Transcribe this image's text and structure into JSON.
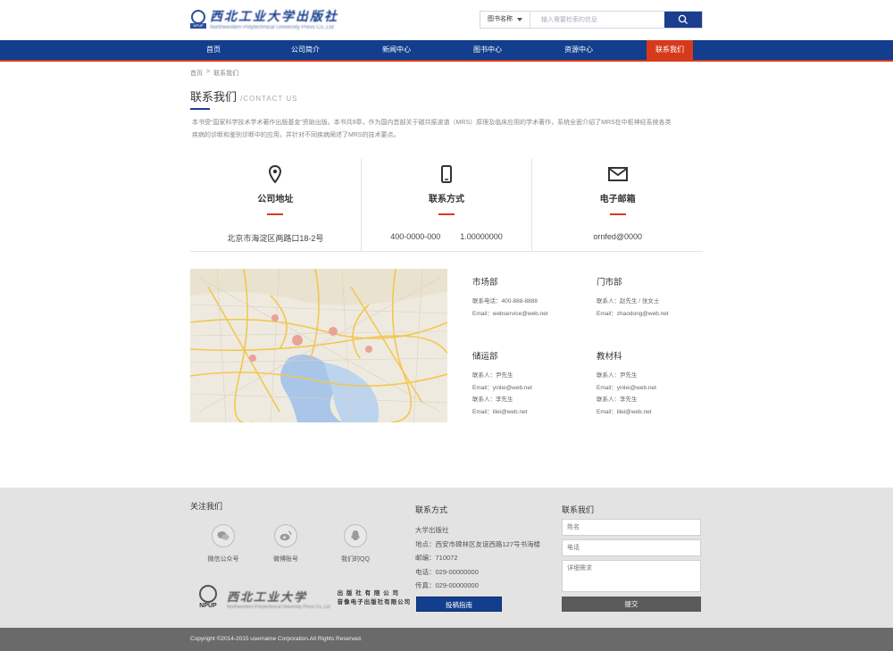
{
  "header": {
    "logo_cn": "西北工业大学出版社",
    "logo_en": "Northwestern Polytechnical University Press Co.,Ltd",
    "logo_mark_text": "NPUP",
    "search": {
      "category": "图书名称",
      "placeholder": "输入需要检索的信息"
    }
  },
  "nav": {
    "items": [
      {
        "label": "首页"
      },
      {
        "label": "公司简介"
      },
      {
        "label": "新闻中心"
      },
      {
        "label": "图书中心"
      },
      {
        "label": "资源中心"
      },
      {
        "label": "联系我们"
      }
    ]
  },
  "breadcrumb": {
    "home": "首页",
    "separator": ">",
    "current": "联系我们"
  },
  "page": {
    "title": "联系我们",
    "title_en": "/CONTACT US",
    "intro_line1": "本书受“国家科学技术学术著作出版基金”资助出版。本书共9章，作为国内首部关于磁共振波谱（MRS）原理及临床应用的学术著作，系统全面介绍了MRS在中枢神经系统各类",
    "intro_line2": "疾病的诊断和鉴别诊断中的应用，并针对不同疾病阐述了MRS的技术要点。"
  },
  "contact_cols": [
    {
      "title": "公司地址",
      "value": "北京市海淀区两路口18-2号"
    },
    {
      "title": "联系方式",
      "value1": "400-0000-000",
      "value2": "1.00000000"
    },
    {
      "title": "电子邮箱",
      "value": "ornfed@0000"
    }
  ],
  "departments": [
    {
      "title": "市场部",
      "lines": [
        "联系电话：400-888-8888",
        "Email：webservice@web.net"
      ]
    },
    {
      "title": "门市部",
      "lines": [
        "联系人：赵先生 / 张女士",
        "Email：zhaodong@web.net"
      ]
    },
    {
      "title": "储运部",
      "lines": [
        "联系人：尹先生",
        "Email：yinlei@web.net",
        "联系人：李先生",
        "Email：lilei@web.net"
      ]
    },
    {
      "title": "教材科",
      "lines": [
        "联系人：尹先生",
        "Email：yinlei@web.net",
        "联系人：李先生",
        "Email：lilei@web.net"
      ]
    }
  ],
  "footer": {
    "follow_title": "关注我们",
    "social": [
      {
        "label": "微信公众号",
        "icon": "wechat-icon"
      },
      {
        "label": "微博账号",
        "icon": "weibo-icon"
      },
      {
        "label": "我们的QQ",
        "icon": "qq-icon"
      }
    ],
    "logo_cn": "西北工业大学",
    "logo_en": "Northwestern Polytechnical University Press Co.,Ltd",
    "logo_mark_text": "NPUP",
    "press_line1": "出 版 社 有 限 公 司",
    "press_line2": "音像电子出版社有限公司",
    "contact_title": "联系方式",
    "contact_lines": [
      "大学出版社",
      "地点：西安市碑林区友谊西路127号书海楼",
      "邮编：710072",
      "电话：029-00000000",
      "传真：029-00000000"
    ],
    "submit_guide_label": "投稿指南",
    "form_title": "联系我们",
    "form": {
      "name_placeholder": "姓名",
      "phone_placeholder": "电话",
      "details_placeholder": "详细需求",
      "submit_label": "提交"
    },
    "copyright": "Copyright ©2014-2015 username Corporation.All Rights Reserved."
  },
  "colors": {
    "brand_blue": "#123e8d",
    "accent_red": "#d63a1c"
  }
}
